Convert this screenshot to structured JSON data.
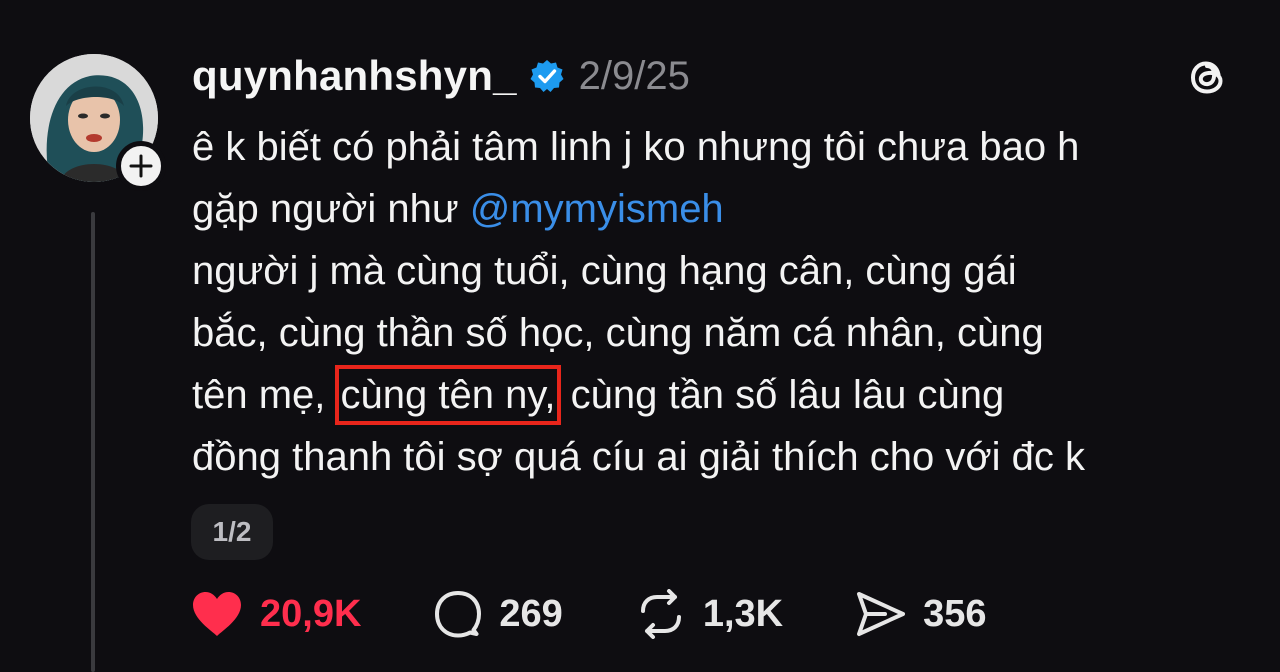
{
  "post": {
    "author": {
      "username": "quynhanhshyn_",
      "verified": true,
      "avatar_icon": "profile-photo"
    },
    "date": "2/9/25",
    "app_icon": "threads-logo-icon",
    "text": {
      "line1": "ê k biết có phải tâm linh j ko nhưng tôi chưa bao h",
      "line2_pre": "gặp người như ",
      "mention": "@mymyismeh",
      "line3": "người j mà cùng tuổi, cùng hạng cân, cùng gái",
      "line4": "bắc, cùng thần số học, cùng năm cá nhân, cùng",
      "line5_pre": "tên mẹ, ",
      "line5_highlight": "cùng tên ny,",
      "line5_post": " cùng tần số lâu lâu cùng",
      "line6": "đồng thanh tôi sợ quá cíu ai giải thích cho với đc k"
    },
    "page_indicator": "1/2",
    "actions": {
      "likes": "20,9K",
      "comments": "269",
      "reposts": "1,3K",
      "shares": "356"
    },
    "colors": {
      "background": "#0e0d11",
      "mention": "#3a8ee8",
      "like": "#ff2e4d",
      "highlight_box": "#e8251b",
      "verified": "#1d9bf0"
    }
  }
}
